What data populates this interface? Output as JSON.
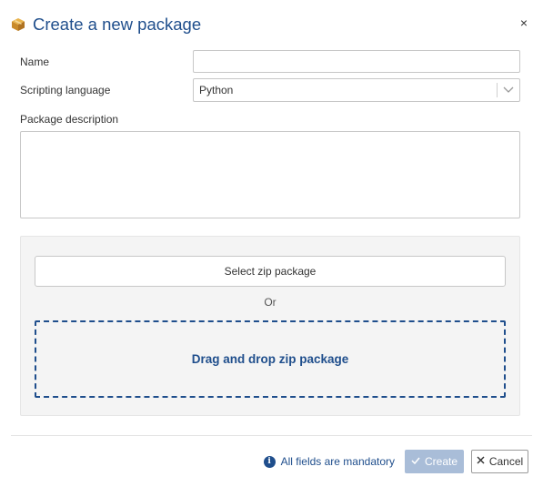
{
  "dialog": {
    "title": "Create a new package",
    "close_symbol": "×"
  },
  "form": {
    "name_label": "Name",
    "name_value": "",
    "language_label": "Scripting language",
    "language_value": "Python",
    "description_label": "Package description",
    "description_value": ""
  },
  "upload": {
    "select_button_label": "Select zip package",
    "or_label": "Or",
    "dropzone_label": "Drag and drop zip package"
  },
  "footer": {
    "mandatory_text": "All fields are mandatory",
    "create_label": "Create",
    "cancel_label": "Cancel"
  },
  "icons": {
    "title": "package-icon",
    "close": "close-icon",
    "select_arrow": "chevron-down-icon",
    "info": "info-icon",
    "create": "check-icon",
    "cancel": "close-icon"
  },
  "colors": {
    "accent": "#1f4e8c",
    "create_disabled_bg": "#a9bdd8",
    "panel_bg": "#f4f4f4"
  }
}
